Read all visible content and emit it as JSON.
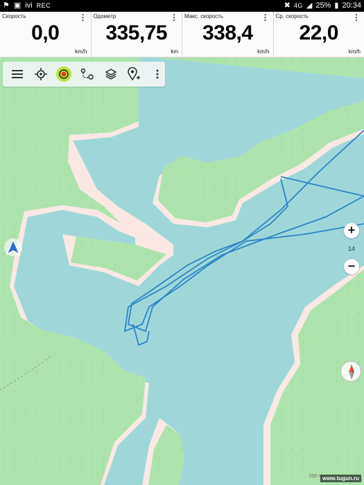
{
  "status_bar": {
    "left_icons": [
      "location-icon",
      "image-icon",
      "ivi-icon",
      "rec-icon"
    ],
    "app_label": "ivi",
    "rec_label": "REC",
    "network": "4G",
    "battery": "25%",
    "time": "20:34"
  },
  "widgets": [
    {
      "label": "Скорость",
      "value": "0,0",
      "unit": "km/h"
    },
    {
      "label": "Одометр",
      "value": "335,75",
      "unit": "km"
    },
    {
      "label": "Макс. скорость",
      "value": "338,4",
      "unit": "km/h"
    },
    {
      "label": "Ср. скорость",
      "value": "22,0",
      "unit": "km/h"
    }
  ],
  "toolbar": {
    "icons": [
      "menu-icon",
      "crosshair-icon",
      "record-icon",
      "route-icon",
      "layers-icon",
      "add-pin-icon",
      "more-icon"
    ],
    "active_icon": "record-icon",
    "accent_color": "#b9e23a"
  },
  "zoom": {
    "plus": "+",
    "level": "14",
    "minus": "−"
  },
  "map": {
    "water_color": "#9fd7d9",
    "land_color": "#ade4ae",
    "shore_color": "#fbe8e4",
    "forest_dot_color": "#8fce8e",
    "track_color": "#2c86c6"
  },
  "scale_label": "250 m",
  "watermark": "www.tugun.ru"
}
